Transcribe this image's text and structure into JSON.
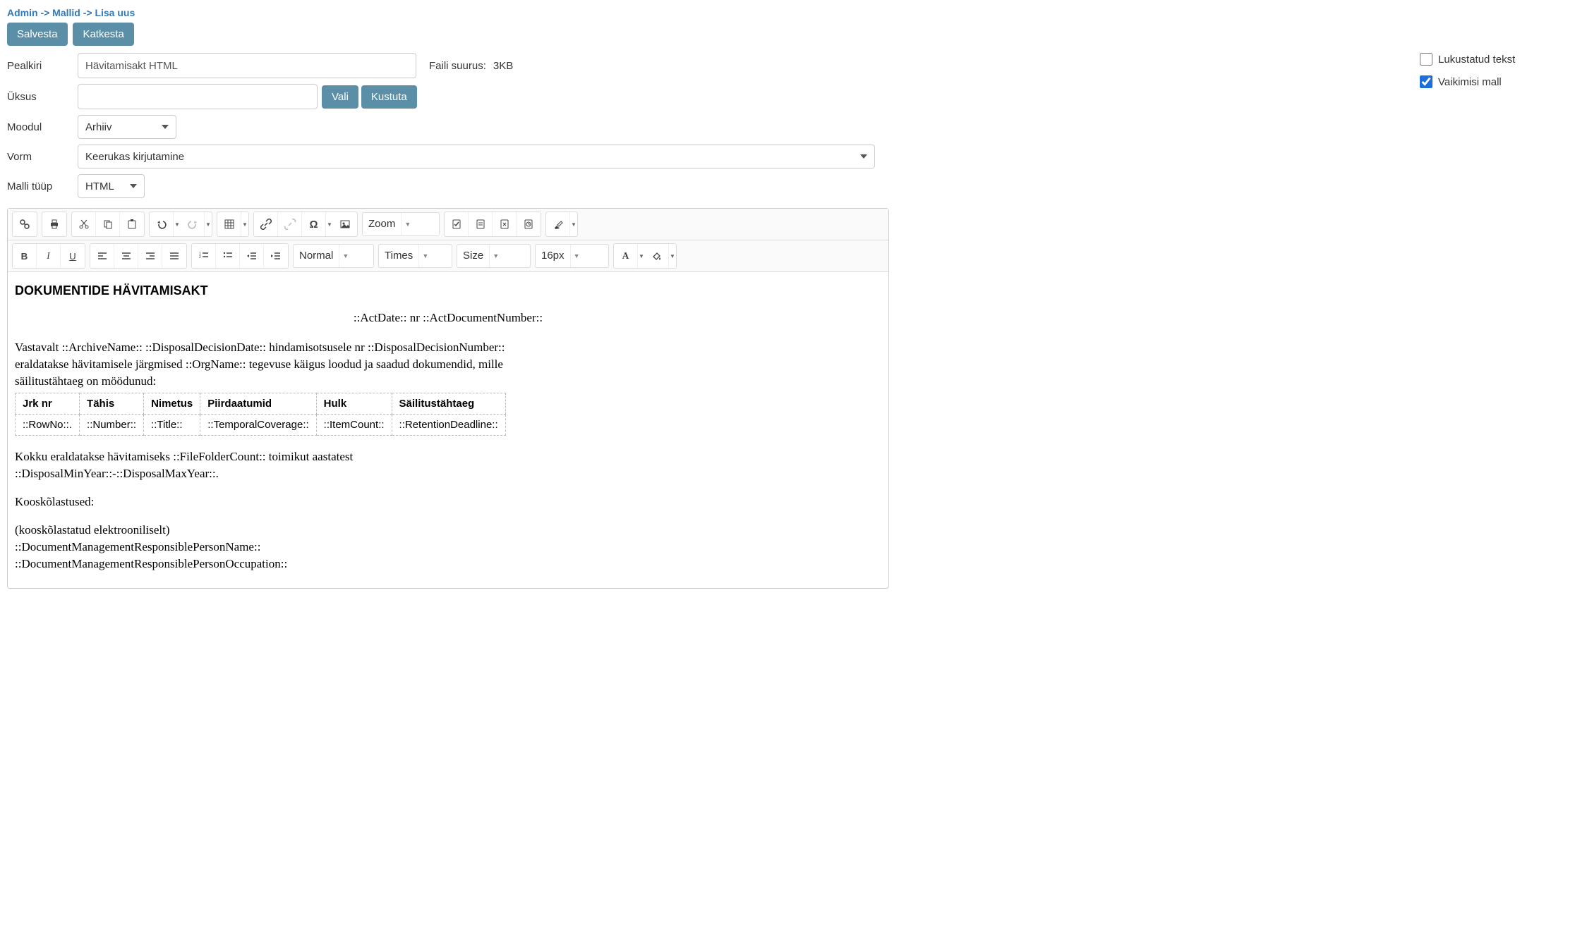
{
  "breadcrumb": "Admin -> Mallid -> Lisa uus",
  "buttons": {
    "save": "Salvesta",
    "cancel": "Katkesta",
    "choose": "Vali",
    "delete": "Kustuta"
  },
  "form": {
    "title_label": "Pealkiri",
    "title_value": "Hävitamisakt HTML",
    "unit_label": "Üksus",
    "unit_value": "",
    "module_label": "Moodul",
    "module_value": "Arhiiv",
    "form_label": "Vorm",
    "form_value": "Keerukas kirjutamine",
    "type_label": "Malli tüüp",
    "type_value": "HTML",
    "file_size_label": "Faili suurus:",
    "file_size_value": "3KB"
  },
  "checkboxes": {
    "locked_label": "Lukustatud tekst",
    "locked_checked": false,
    "default_label": "Vaikimisi mall",
    "default_checked": true
  },
  "toolbar": {
    "zoom_label": "Zoom",
    "format_value": "Normal",
    "font_value": "Times",
    "size_placeholder": "Size",
    "px_value": "16px"
  },
  "doc": {
    "heading": "DOKUMENTIDE HÄVITAMISAKT",
    "line_center": "::ActDate:: nr ::ActDocumentNumber::",
    "para1_l1": "Vastavalt ::ArchiveName:: ::DisposalDecisionDate:: hindamisotsusele nr ::DisposalDecisionNumber::",
    "para1_l2": "eraldatakse hävitamisele järgmised ::OrgName:: tegevuse käigus loodud ja saadud dokumendid, mille",
    "para1_l3": "säilitustähtaeg on möödunud:",
    "table": {
      "headers": [
        "Jrk nr",
        "Tähis",
        "Nimetus",
        "Piirdaatumid",
        "Hulk",
        "Säilitustähtaeg"
      ],
      "row": [
        "::RowNo::.",
        "::Number::",
        "::Title::",
        "::TemporalCoverage::",
        "::ItemCount::",
        "::RetentionDeadline::"
      ]
    },
    "para2_l1": "Kokku eraldatakse hävitamiseks ::FileFolderCount:: toimikut aastatest",
    "para2_l2": "::DisposalMinYear::-::DisposalMaxYear::.",
    "para3": "Kooskõlastused:",
    "para4_l1": "(kooskõlastatud elektrooniliselt)",
    "para4_l2": "::DocumentManagementResponsiblePersonName::",
    "para4_l3": "::DocumentManagementResponsiblePersonOccupation::"
  }
}
